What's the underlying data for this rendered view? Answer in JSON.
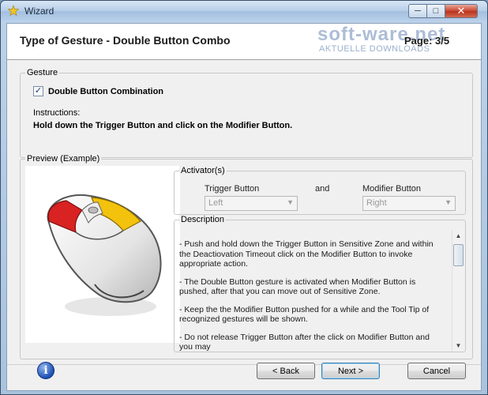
{
  "window": {
    "title": "Wizard"
  },
  "header": {
    "title": "Type of Gesture - Double Button Combo",
    "page": "Page: 3/5"
  },
  "watermark": {
    "main": "soft-ware.net",
    "sub": "AKTUELLE DOWNLOADS"
  },
  "gesture": {
    "group_title": "Gesture",
    "checkbox_label": "Double Button Combination",
    "checked": true,
    "instructions_label": "Instructions:",
    "instructions_text": "Hold down the Trigger Button and click on the Modifier Button."
  },
  "preview": {
    "group_title": "Preview (Example)",
    "activators": {
      "group_title": "Activator(s)",
      "trigger_label": "Trigger Button",
      "and_label": "and",
      "modifier_label": "Modifier Button",
      "trigger_value": "Left",
      "modifier_value": "Right"
    },
    "description": {
      "group_title": "Description",
      "paragraphs": [
        "- Push and hold down the Trigger Button in Sensitive Zone and within the Deactiovation Timeout click on the Modifier Button to invoke appropriate action.",
        "- The Double Button gesture is activated when Modifier Button is pushed, after that you can move out of Sensitive Zone.",
        "- Keep the the Modifier Button pushed for a while and the Tool Tip of recognized gestures will be shown.",
        "- Do not release Trigger Button after the click on Modifier Button and you may"
      ]
    }
  },
  "footer": {
    "back_label": "< Back",
    "next_label": "Next >",
    "cancel_label": "Cancel"
  },
  "colors": {
    "mouse_red": "#d92222",
    "mouse_yellow": "#f2c20c",
    "accent_blue": "#3c7fb1"
  }
}
